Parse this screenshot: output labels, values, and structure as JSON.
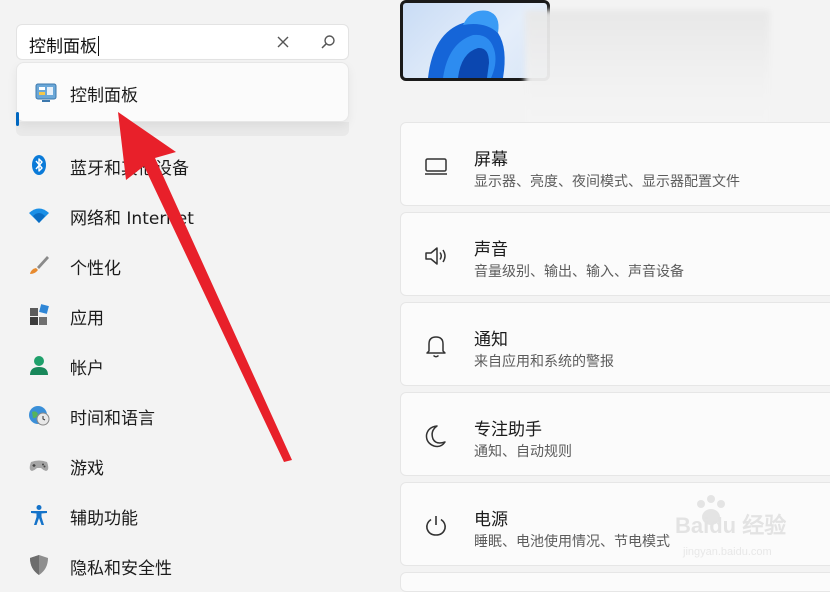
{
  "search": {
    "value": "控制面板",
    "suggestion": "控制面板"
  },
  "nav": {
    "items": [
      {
        "label": "蓝牙和其他设备",
        "icon": "bluetooth-icon"
      },
      {
        "label": "网络和 Internet",
        "icon": "wifi-icon"
      },
      {
        "label": "个性化",
        "icon": "brush-icon"
      },
      {
        "label": "应用",
        "icon": "apps-icon"
      },
      {
        "label": "帐户",
        "icon": "person-icon"
      },
      {
        "label": "时间和语言",
        "icon": "globe-clock-icon"
      },
      {
        "label": "游戏",
        "icon": "gamepad-icon"
      },
      {
        "label": "辅助功能",
        "icon": "accessibility-icon"
      },
      {
        "label": "隐私和安全性",
        "icon": "shield-icon"
      }
    ]
  },
  "cards": [
    {
      "title": "屏幕",
      "desc": "显示器、亮度、夜间模式、显示器配置文件",
      "icon": "monitor-icon"
    },
    {
      "title": "声音",
      "desc": "音量级别、输出、输入、声音设备",
      "icon": "speaker-icon"
    },
    {
      "title": "通知",
      "desc": "来自应用和系统的警报",
      "icon": "bell-icon"
    },
    {
      "title": "专注助手",
      "desc": "通知、自动规则",
      "icon": "moon-icon"
    },
    {
      "title": "电源",
      "desc": "睡眠、电池使用情况、节电模式",
      "icon": "power-icon"
    }
  ],
  "watermark": {
    "brand": "Baidu 经验",
    "url": "jingyan.baidu.com"
  },
  "colors": {
    "accent": "#0067c0",
    "arrow": "#e8202a"
  }
}
